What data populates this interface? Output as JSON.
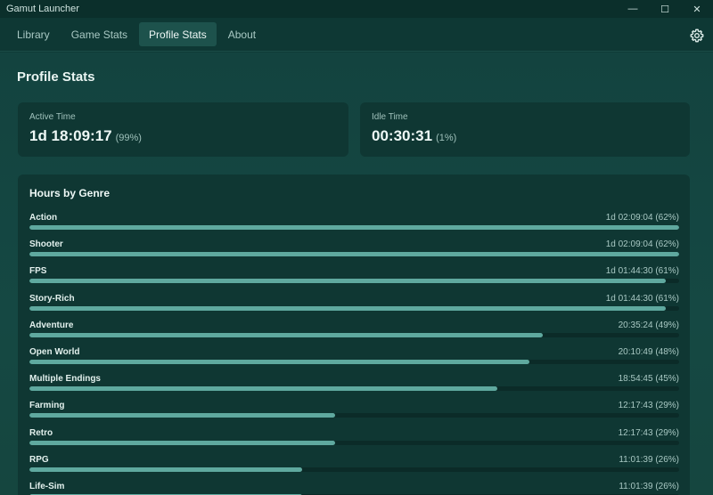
{
  "window": {
    "title": "Gamut Launcher",
    "minimize_glyph": "—",
    "maximize_glyph": "☐",
    "close_glyph": "✕"
  },
  "nav": {
    "tabs": [
      {
        "label": "Library",
        "active": false
      },
      {
        "label": "Game Stats",
        "active": false
      },
      {
        "label": "Profile Stats",
        "active": true
      },
      {
        "label": "About",
        "active": false
      }
    ],
    "settings_icon": "gear-icon"
  },
  "page": {
    "title": "Profile Stats"
  },
  "stats": {
    "active": {
      "label": "Active Time",
      "value": "1d 18:09:17",
      "percent": "(99%)"
    },
    "idle": {
      "label": "Idle Time",
      "value": "00:30:31",
      "percent": "(1%)"
    }
  },
  "genres": {
    "title": "Hours by Genre",
    "items": [
      {
        "name": "Action",
        "time": "1d 02:09:04 (62%)",
        "fraction": 1.0
      },
      {
        "name": "Shooter",
        "time": "1d 02:09:04 (62%)",
        "fraction": 1.0
      },
      {
        "name": "FPS",
        "time": "1d 01:44:30 (61%)",
        "fraction": 0.98
      },
      {
        "name": "Story-Rich",
        "time": "1d 01:44:30 (61%)",
        "fraction": 0.98
      },
      {
        "name": "Adventure",
        "time": "20:35:24 (49%)",
        "fraction": 0.79
      },
      {
        "name": "Open World",
        "time": "20:10:49 (48%)",
        "fraction": 0.77
      },
      {
        "name": "Multiple Endings",
        "time": "18:54:45 (45%)",
        "fraction": 0.72
      },
      {
        "name": "Farming",
        "time": "12:17:43 (29%)",
        "fraction": 0.47
      },
      {
        "name": "Retro",
        "time": "12:17:43 (29%)",
        "fraction": 0.47
      },
      {
        "name": "RPG",
        "time": "11:01:39 (26%)",
        "fraction": 0.42
      },
      {
        "name": "Life-Sim",
        "time": "11:01:39 (26%)",
        "fraction": 0.42
      }
    ]
  },
  "colors": {
    "accent": "#5fa99f",
    "active_tab": "#1d524c",
    "card": "#0f3733"
  }
}
